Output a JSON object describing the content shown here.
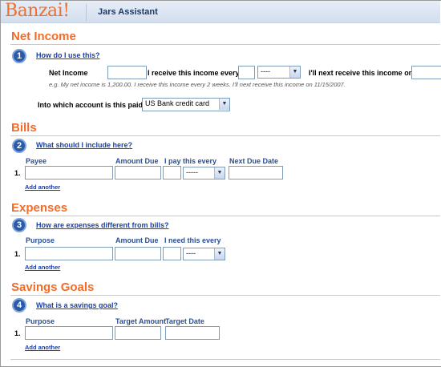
{
  "header": {
    "logo": "Banzai",
    "logo_mark": "!",
    "title": "Jars Assistant"
  },
  "net_income": {
    "title": "Net Income",
    "step": "1",
    "help": "How do I use this?",
    "net_income_label": "Net Income",
    "net_income_value": "",
    "every_label": "I receive this income every",
    "every_value": "",
    "period_select": "----",
    "next_label": "I'll next receive this income on",
    "next_value": "",
    "example": "e.g. My net income is 1,200.00. I receive this income every 2 weeks. I'll next receive this income on 11/15/2007.",
    "account_label": "Into which account is this paid?",
    "account_select": "US Bank credit card"
  },
  "bills": {
    "title": "Bills",
    "step": "2",
    "help": "What should I include here?",
    "columns": [
      "Payee",
      "Amount Due",
      "I pay this every",
      "Next Due Date"
    ],
    "row_num": "1.",
    "period_select": "-----",
    "add": "Add another"
  },
  "expenses": {
    "title": "Expenses",
    "step": "3",
    "help": "How are expenses different from bills?",
    "columns": [
      "Purpose",
      "Amount Due",
      "I need this every"
    ],
    "row_num": "1.",
    "period_select": "----",
    "add": "Add another"
  },
  "savings": {
    "title": "Savings Goals",
    "step": "4",
    "help": "What is a savings goal?",
    "columns": [
      "Purpose",
      "Target Amount",
      "Target Date"
    ],
    "row_num": "1.",
    "add": "Add another"
  },
  "colors": {
    "accent": "#f26c2a",
    "link": "#1a3fa6",
    "step": "#2a5aa8"
  }
}
